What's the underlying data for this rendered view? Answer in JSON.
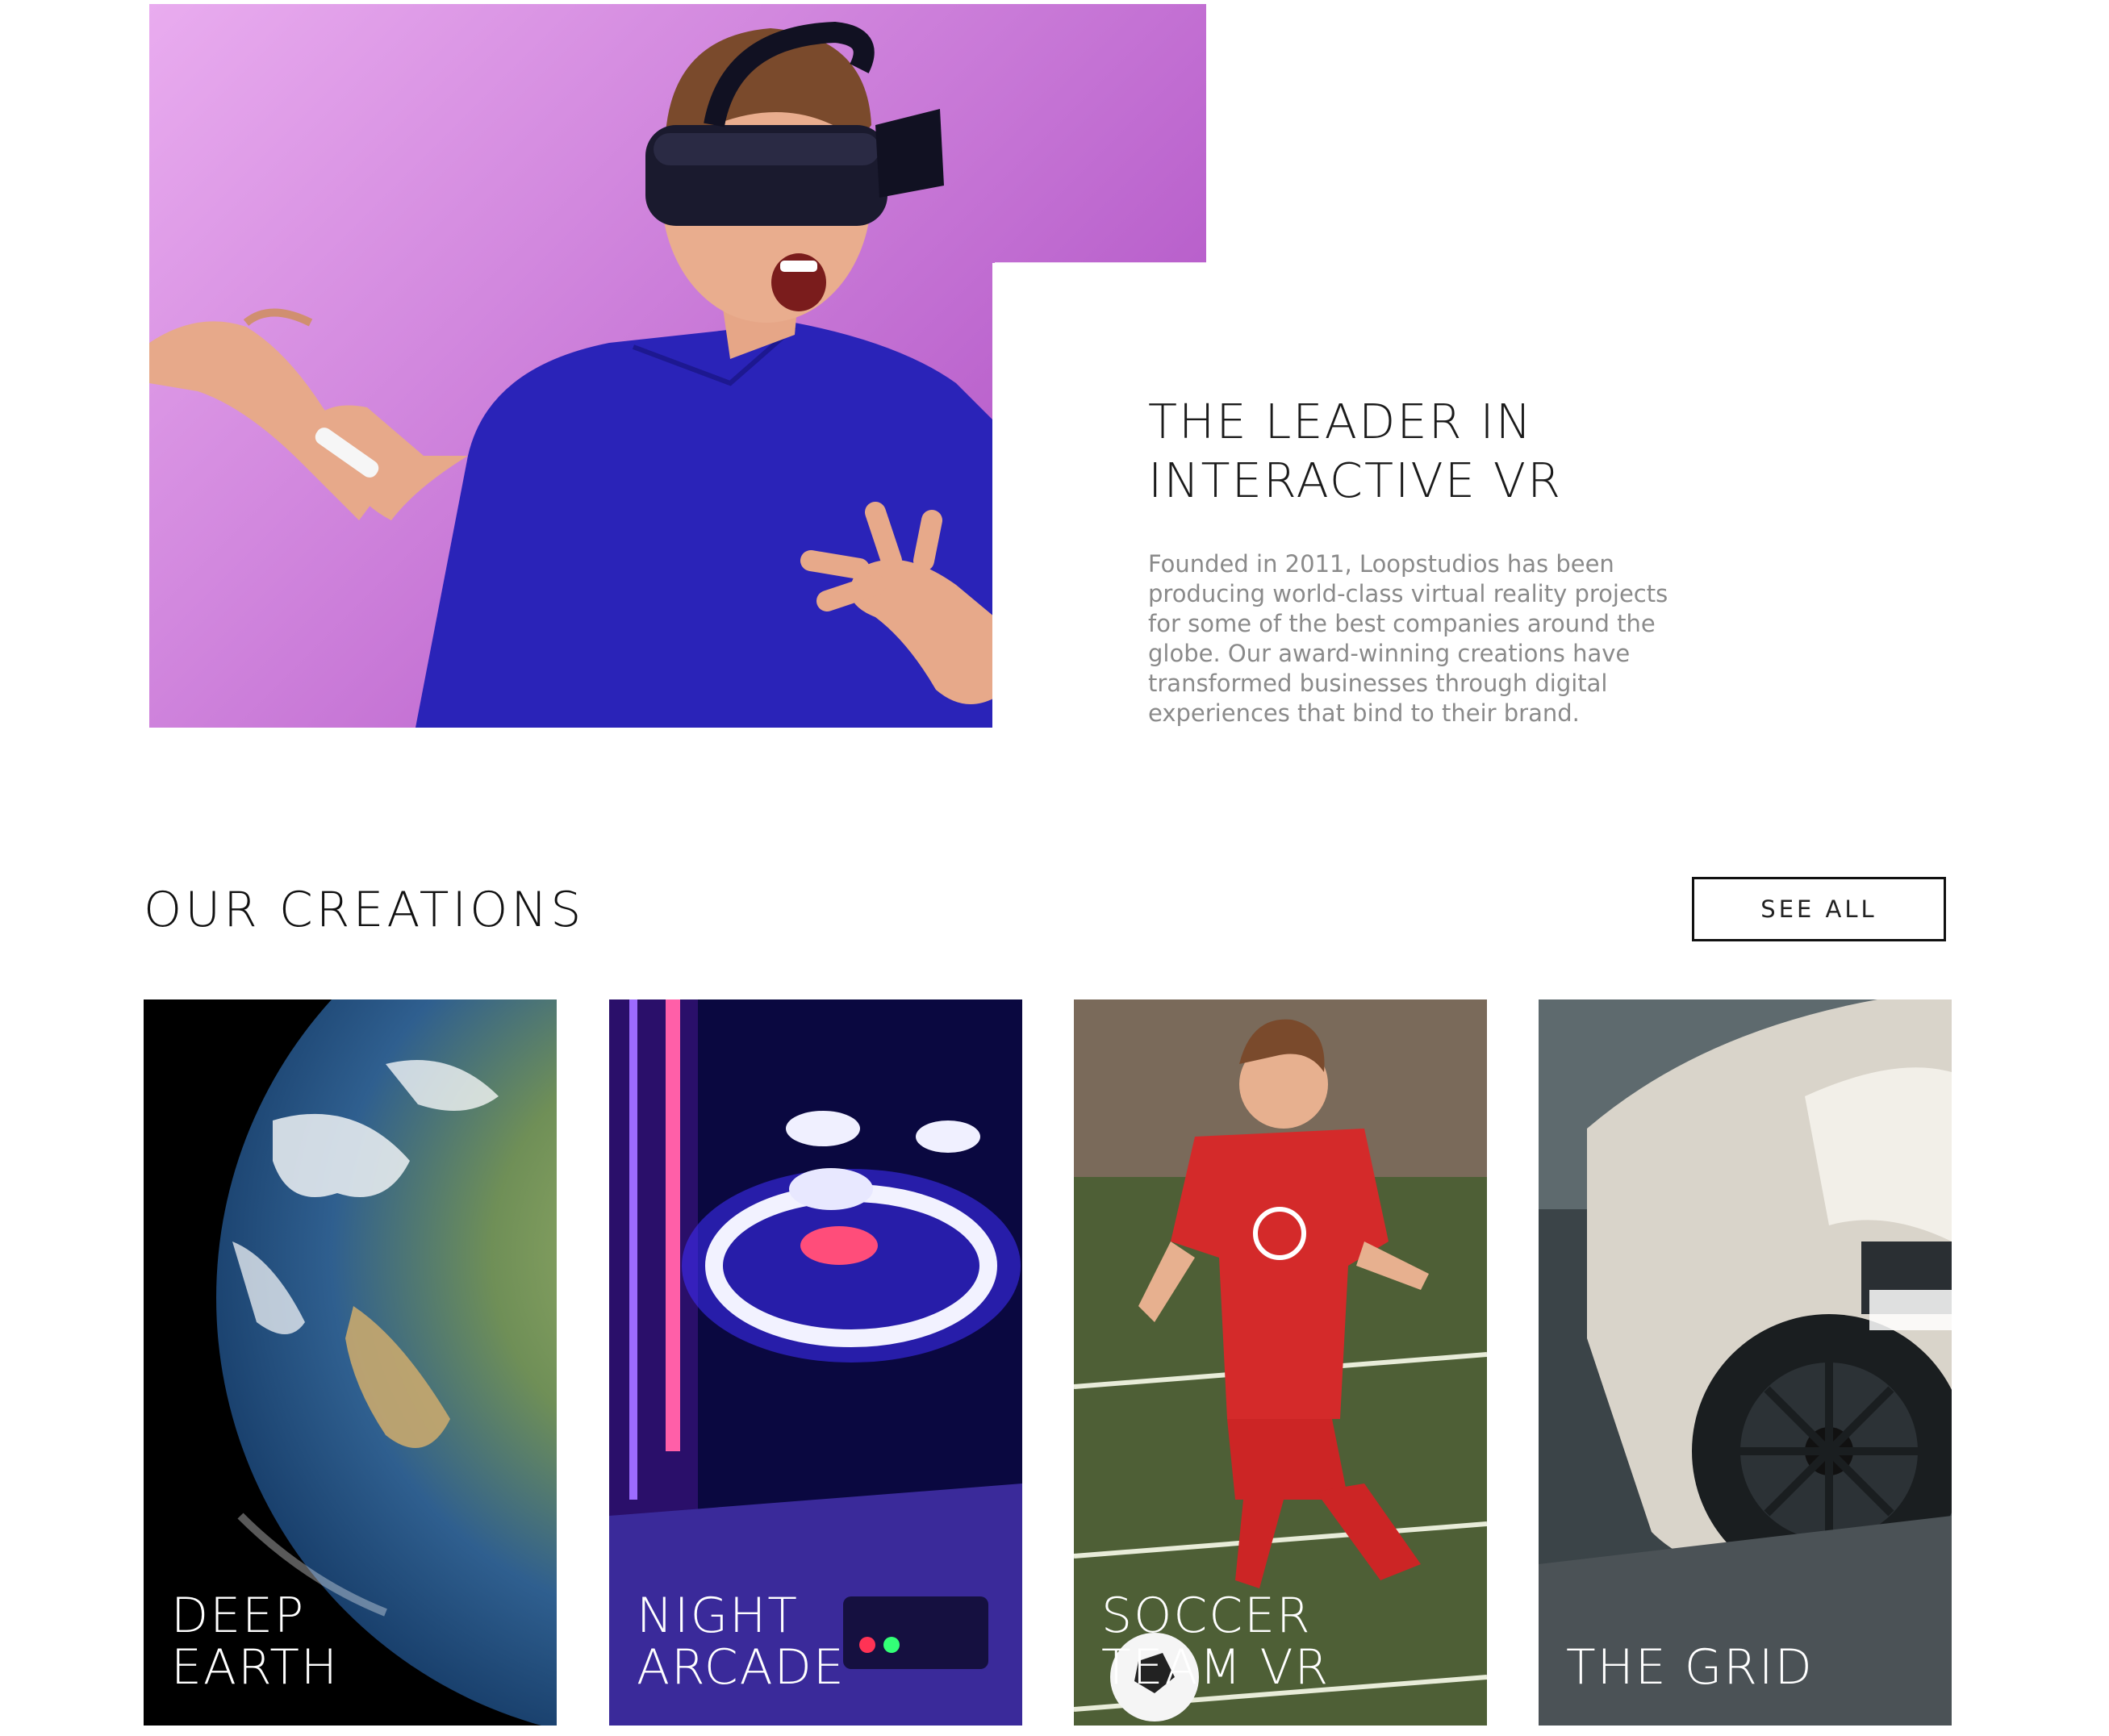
{
  "hero": {
    "image_alt": "Man wearing VR headset",
    "title_line1": "THE LEADER IN",
    "title_line2": "INTERACTIVE VR",
    "description": "Founded in 2011, Loopstudios has been producing world-class virtual reality projects for some of the best companies around the globe. Our award-winning creations have transformed businesses through digital experiences that bind to their brand."
  },
  "creations": {
    "title": "OUR CREATIONS",
    "see_all_label": "SEE ALL",
    "items": [
      {
        "line1": "DEEP",
        "line2": "EARTH"
      },
      {
        "line1": "NIGHT",
        "line2": "ARCADE"
      },
      {
        "line1": "SOCCER",
        "line2": "TEAM VR"
      },
      {
        "line1": "THE GRID",
        "line2": ""
      }
    ]
  },
  "colors": {
    "accent_purple": "#c77ad8",
    "text_dark": "#1b1b1b",
    "text_muted": "#8a8a8a"
  }
}
